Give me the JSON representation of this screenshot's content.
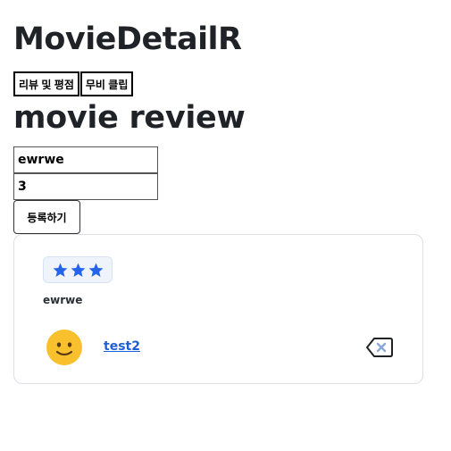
{
  "header": {
    "title": "MovieDetailR"
  },
  "tabs": [
    {
      "label": "리뷰 및 평점"
    },
    {
      "label": "무비 클립"
    }
  ],
  "section": {
    "title": "movie review"
  },
  "form": {
    "review_value": "ewrwe",
    "rating_value": "3",
    "submit_label": "등록하기"
  },
  "reviews": [
    {
      "rating": 3,
      "text": "ewrwe",
      "author": "test2",
      "avatar_icon": "smiley-face-icon",
      "delete_icon": "backspace-delete-icon"
    }
  ],
  "colors": {
    "star": "#2563eb",
    "star_badge_bg": "#eef3fc",
    "author_link": "#1f5fd6",
    "avatar": "#f7c02c"
  }
}
